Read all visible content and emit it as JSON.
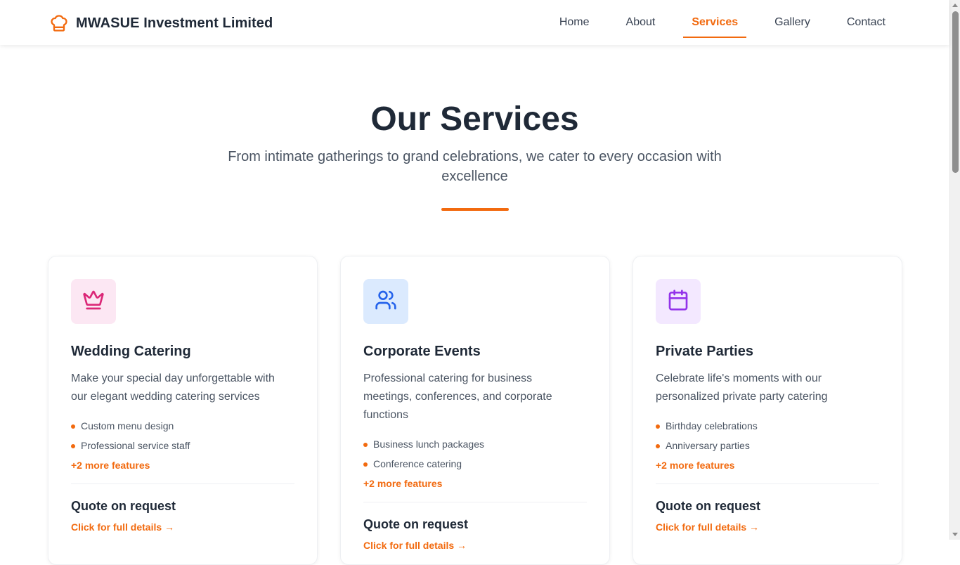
{
  "brand": {
    "name": "MWASUE Investment Limited",
    "icon": "chef-hat-icon"
  },
  "nav": {
    "items": [
      {
        "label": "Home"
      },
      {
        "label": "About"
      },
      {
        "label": "Services",
        "active": true
      },
      {
        "label": "Gallery"
      },
      {
        "label": "Contact"
      }
    ]
  },
  "hero": {
    "title": "Our Services",
    "subtitle": "From intimate gatherings to grand celebrations, we cater to every occasion with excellence"
  },
  "cards": [
    {
      "icon": "crown-icon",
      "icon_color": "#db2777",
      "icon_bg": "#fce7f3",
      "title": "Wedding Catering",
      "description": "Make your special day unforgettable with our elegant wedding catering services",
      "features": [
        "Custom menu design",
        "Professional service staff"
      ],
      "more": "+2 more features",
      "price": "Quote on request",
      "link": "Click for full details →"
    },
    {
      "icon": "users-icon",
      "icon_color": "#2563eb",
      "icon_bg": "#dbeafe",
      "title": "Corporate Events",
      "description": "Professional catering for business meetings, conferences, and corporate functions",
      "features": [
        "Business lunch packages",
        "Conference catering"
      ],
      "more": "+2 more features",
      "price": "Quote on request",
      "link": "Click for full details →"
    },
    {
      "icon": "calendar-icon",
      "icon_color": "#9333ea",
      "icon_bg": "#f3e8ff",
      "title": "Private Parties",
      "description": "Celebrate life's moments with our personalized private party catering",
      "features": [
        "Birthday celebrations",
        "Anniversary parties"
      ],
      "more": "+2 more features",
      "price": "Quote on request",
      "link": "Click for full details →"
    }
  ],
  "colors": {
    "accent": "#f26a0f",
    "heading": "#1f2937",
    "body": "#4b5563"
  }
}
